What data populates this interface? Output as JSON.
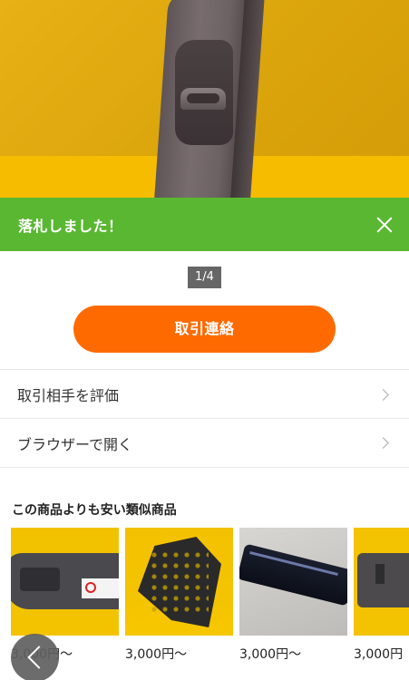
{
  "banner": {
    "text": "落札しました！"
  },
  "pager": {
    "text": "1/4"
  },
  "cta": {
    "label": "取引連絡"
  },
  "menu": [
    {
      "label": "取引相手を評価"
    },
    {
      "label": "ブラウザーで開く"
    }
  ],
  "similar": {
    "title": "この商品よりも安い類似商品",
    "items": [
      {
        "price": "3,000円〜"
      },
      {
        "price": "3,000円〜"
      },
      {
        "price": "3,000円〜"
      },
      {
        "price": "3,000円"
      }
    ]
  },
  "colors": {
    "banner": "#5ab732",
    "cta": "#ff6a00"
  },
  "icons": [
    "close-icon",
    "chevron-right-icon",
    "back-icon"
  ]
}
